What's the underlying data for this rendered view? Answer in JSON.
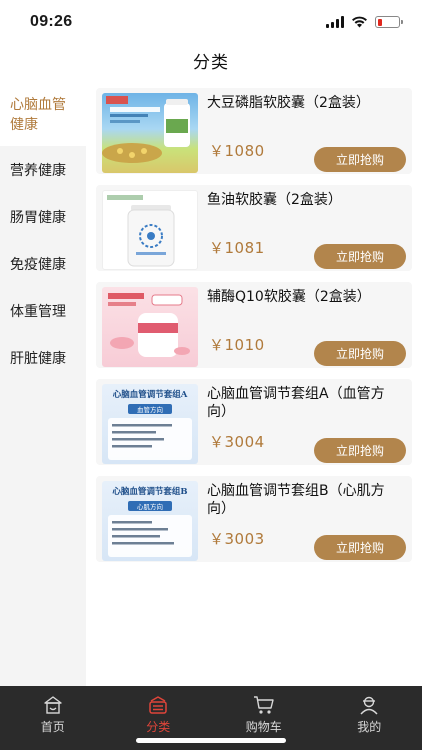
{
  "status_bar": {
    "time": "09:26",
    "battery_color": "#e0271d"
  },
  "page": {
    "title": "分类"
  },
  "sidebar": {
    "items": [
      {
        "label": "心脑血管健康",
        "active": true
      },
      {
        "label": "营养健康"
      },
      {
        "label": "肠胃健康"
      },
      {
        "label": "免疫健康"
      },
      {
        "label": "体重管理"
      },
      {
        "label": "肝脏健康"
      }
    ]
  },
  "products": [
    {
      "name": "大豆磷脂软胶囊（2盒装）",
      "price": "￥1080",
      "buy_label": "立即抢购",
      "thumb": "soy-lecithin-box"
    },
    {
      "name": "鱼油软胶囊（2盒装）",
      "price": "￥1081",
      "buy_label": "立即抢购",
      "thumb": "fish-oil-bottle"
    },
    {
      "name": "辅酶Q10软胶囊（2盒装）",
      "price": "￥1010",
      "buy_label": "立即抢购",
      "thumb": "coq10-box"
    },
    {
      "name": "心脑血管调节套组A（血管方向）",
      "price": "￥3004",
      "buy_label": "立即抢购",
      "thumb": "set-a-card",
      "thumb_title": "心脑血管调节套组A",
      "thumb_sub": "血管方向"
    },
    {
      "name": "心脑血管调节套组B（心肌方向）",
      "price": "￥3003",
      "buy_label": "立即抢购",
      "thumb": "set-b-card",
      "thumb_title": "心脑血管调节套组B",
      "thumb_sub": "心肌方向"
    }
  ],
  "tabbar": {
    "items": [
      {
        "label": "首页",
        "icon": "home-icon"
      },
      {
        "label": "分类",
        "icon": "category-icon",
        "active": true
      },
      {
        "label": "购物车",
        "icon": "cart-icon"
      },
      {
        "label": "我的",
        "icon": "profile-icon"
      }
    ]
  },
  "colors": {
    "accent": "#b07a3b",
    "button": "#b2854c",
    "tab_active": "#e0453a",
    "tabbar_bg": "#2b2b2b"
  }
}
